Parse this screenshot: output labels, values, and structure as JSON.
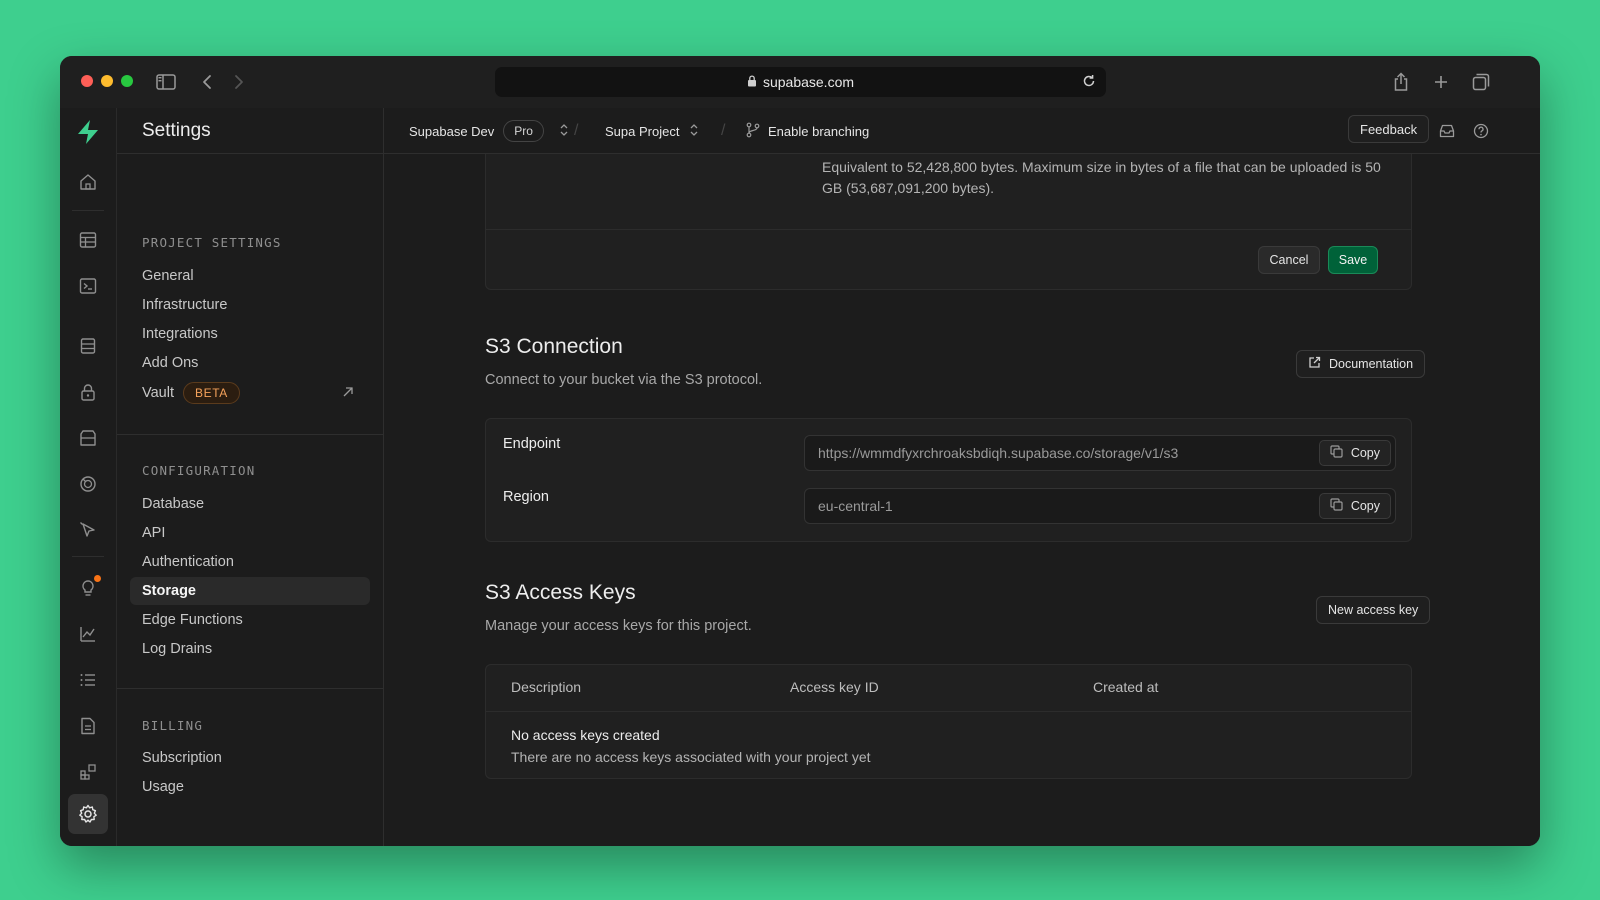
{
  "browser": {
    "url": "supabase.com"
  },
  "rail": {
    "icons": [
      "supabase-logo",
      "home-icon",
      "table-editor-icon",
      "sql-editor-icon",
      "database-icon",
      "auth-icon",
      "storage-icon",
      "realtime-icon",
      "edge-functions-icon",
      "advisors-icon",
      "reports-icon",
      "logs-icon",
      "api-docs-icon",
      "integrations-icon",
      "settings-icon"
    ]
  },
  "sidebar": {
    "title": "Settings",
    "project_settings": {
      "title": "PROJECT SETTINGS",
      "items": [
        "General",
        "Infrastructure",
        "Integrations",
        "Add Ons",
        "Vault"
      ],
      "vault_badge": "BETA"
    },
    "configuration": {
      "title": "CONFIGURATION",
      "items": [
        "Database",
        "API",
        "Authentication",
        "Storage",
        "Edge Functions",
        "Log Drains"
      ],
      "active": "Storage"
    },
    "billing": {
      "title": "BILLING",
      "items": [
        "Subscription",
        "Usage"
      ]
    }
  },
  "topbar": {
    "org": "Supabase Dev",
    "plan": "Pro",
    "project": "Supa Project",
    "branching": "Enable branching",
    "feedback": "Feedback"
  },
  "upload_limit": {
    "description": "Equivalent to 52,428,800 bytes. Maximum size in bytes of a file that can be uploaded is 50 GB (53,687,091,200 bytes).",
    "cancel": "Cancel",
    "save": "Save"
  },
  "s3_connection": {
    "title": "S3 Connection",
    "subtitle": "Connect to your bucket via the S3 protocol.",
    "documentation": "Documentation",
    "endpoint_label": "Endpoint",
    "endpoint_value": "https://wmmdfyxrchroaksbdiqh.supabase.co/storage/v1/s3",
    "region_label": "Region",
    "region_value": "eu-central-1",
    "copy": "Copy"
  },
  "s3_access_keys": {
    "title": "S3 Access Keys",
    "subtitle": "Manage your access keys for this project.",
    "new_key": "New access key",
    "columns": [
      "Description",
      "Access key ID",
      "Created at"
    ],
    "empty_title": "No access keys created",
    "empty_subtitle": "There are no access keys associated with your project yet"
  },
  "colors": {
    "brand": "#3ecf8e",
    "save_button": "#006239",
    "beta_badge": "#f5a25b",
    "notification": "#f97316"
  }
}
